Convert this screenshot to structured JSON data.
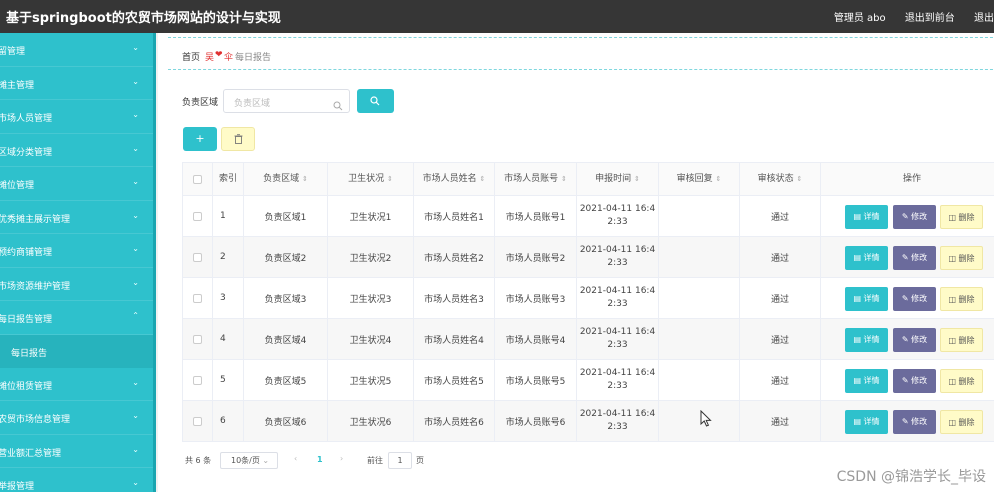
{
  "header": {
    "title": "基于springboot的农贸市场网站的设计与实现",
    "user": "管理员 abo",
    "to_front": "退出到前台",
    "logout": "退出登"
  },
  "sidebar": {
    "items": [
      {
        "label": "留管理",
        "expanded": false
      },
      {
        "label": "摊主管理",
        "expanded": false
      },
      {
        "label": "市场人员管理",
        "expanded": false
      },
      {
        "label": "区域分类管理",
        "expanded": false
      },
      {
        "label": "摊位管理",
        "expanded": false
      },
      {
        "label": "优秀摊主展示管理",
        "expanded": false
      },
      {
        "label": "预约商铺管理",
        "expanded": false
      },
      {
        "label": "市场资源维护管理",
        "expanded": false
      },
      {
        "label": "每日报告管理",
        "expanded": true
      },
      {
        "label": "摊位租赁管理",
        "expanded": false
      },
      {
        "label": "农贸市场信息管理",
        "expanded": false
      },
      {
        "label": "营业额汇总管理",
        "expanded": false
      },
      {
        "label": "举报管理",
        "expanded": false
      }
    ],
    "active_sub": "每日报告"
  },
  "breadcrumb": {
    "home": "首页",
    "sep_left": "吴",
    "sep_right": "伞",
    "current": "每日报告"
  },
  "search": {
    "label": "负责区域",
    "placeholder": "负责区域"
  },
  "toolbar": {
    "add_label": "+",
    "delete_icon": "trash-icon"
  },
  "table": {
    "headers": [
      "索引",
      "负责区域",
      "卫生状况",
      "市场人员姓名",
      "市场人员账号",
      "申报时间",
      "审核回复",
      "审核状态",
      "操作"
    ],
    "rows": [
      {
        "index": "1",
        "area": "负责区域1",
        "hygiene": "卫生状况1",
        "staff_name": "市场人员姓名1",
        "staff_account": "市场人员账号1",
        "time_a": "2021-04-11 16:4",
        "time_b": "2:33",
        "reply": "",
        "status": "通过"
      },
      {
        "index": "2",
        "area": "负责区域2",
        "hygiene": "卫生状况2",
        "staff_name": "市场人员姓名2",
        "staff_account": "市场人员账号2",
        "time_a": "2021-04-11 16:4",
        "time_b": "2:33",
        "reply": "",
        "status": "通过"
      },
      {
        "index": "3",
        "area": "负责区域3",
        "hygiene": "卫生状况3",
        "staff_name": "市场人员姓名3",
        "staff_account": "市场人员账号3",
        "time_a": "2021-04-11 16:4",
        "time_b": "2:33",
        "reply": "",
        "status": "通过"
      },
      {
        "index": "4",
        "area": "负责区域4",
        "hygiene": "卫生状况4",
        "staff_name": "市场人员姓名4",
        "staff_account": "市场人员账号4",
        "time_a": "2021-04-11 16:4",
        "time_b": "2:33",
        "reply": "",
        "status": "通过"
      },
      {
        "index": "5",
        "area": "负责区域5",
        "hygiene": "卫生状况5",
        "staff_name": "市场人员姓名5",
        "staff_account": "市场人员账号5",
        "time_a": "2021-04-11 16:4",
        "time_b": "2:33",
        "reply": "",
        "status": "通过"
      },
      {
        "index": "6",
        "area": "负责区域6",
        "hygiene": "卫生状况6",
        "staff_name": "市场人员姓名6",
        "staff_account": "市场人员账号6",
        "time_a": "2021-04-11 16:4",
        "time_b": "2:33",
        "reply": "",
        "status": "通过"
      }
    ],
    "actions": {
      "detail": "详情",
      "edit": "修改",
      "delete": "删除"
    }
  },
  "pagination": {
    "total": "共 6 条",
    "page_size": "10条/页",
    "current_page": "1",
    "goto_label": "前往",
    "goto_value": "1",
    "page_unit": "页"
  },
  "watermark": "CSDN @锦浩学长_毕设",
  "colors": {
    "accent": "#2ec1cc",
    "topbar": "#363636",
    "edit": "#6b6b9c",
    "delete_bg": "#fffbc8"
  }
}
